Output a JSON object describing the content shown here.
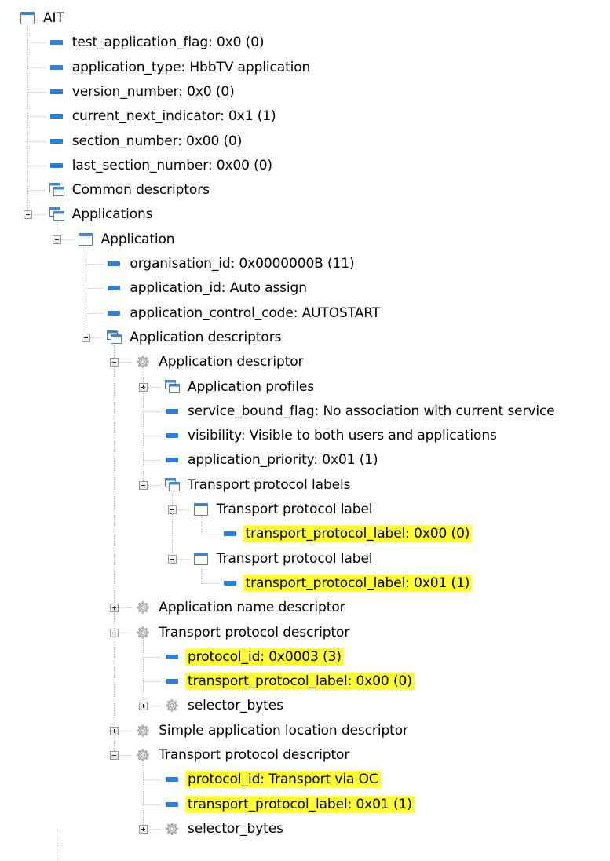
{
  "tree": {
    "nodes": [
      {
        "label": "AIT",
        "icon": "table-icon",
        "name": "node-ait"
      },
      {
        "label": "test_application_flag: 0x0 (0)",
        "icon": "field-icon",
        "name": "node-test-application-flag"
      },
      {
        "label": "application_type: HbbTV application",
        "icon": "field-icon",
        "name": "node-application-type"
      },
      {
        "label": "version_number: 0x0 (0)",
        "icon": "field-icon",
        "name": "node-version-number"
      },
      {
        "label": "current_next_indicator: 0x1 (1)",
        "icon": "field-icon",
        "name": "node-current-next-indicator"
      },
      {
        "label": "section_number: 0x00 (0)",
        "icon": "field-icon",
        "name": "node-section-number"
      },
      {
        "label": "last_section_number: 0x00 (0)",
        "icon": "field-icon",
        "name": "node-last-section-number"
      },
      {
        "label": "Common descriptors",
        "icon": "list-icon",
        "name": "node-common-descriptors"
      },
      {
        "label": "Applications",
        "icon": "list-icon",
        "name": "node-applications",
        "expanded": true
      },
      {
        "label": "Application",
        "icon": "table-icon",
        "name": "node-application",
        "expanded": true
      },
      {
        "label": "organisation_id: 0x0000000B (11)",
        "icon": "field-icon",
        "name": "node-organisation-id"
      },
      {
        "label": "application_id: Auto assign",
        "icon": "field-icon",
        "name": "node-application-id"
      },
      {
        "label": "application_control_code: AUTOSTART",
        "icon": "field-icon",
        "name": "node-application-control-code"
      },
      {
        "label": "Application descriptors",
        "icon": "list-icon",
        "name": "node-application-descriptors",
        "expanded": true
      },
      {
        "label": "Application descriptor",
        "icon": "gear-icon",
        "name": "node-application-descriptor",
        "expanded": true
      },
      {
        "label": "Application profiles",
        "icon": "list-icon",
        "name": "node-application-profiles",
        "expanded": false
      },
      {
        "label": "service_bound_flag: No association with current service",
        "icon": "field-icon",
        "name": "node-service-bound-flag"
      },
      {
        "label": "visibility: Visible to both users and applications",
        "icon": "field-icon",
        "name": "node-visibility"
      },
      {
        "label": "application_priority: 0x01 (1)",
        "icon": "field-icon",
        "name": "node-application-priority"
      },
      {
        "label": "Transport protocol labels",
        "icon": "list-icon",
        "name": "node-transport-protocol-labels",
        "expanded": true
      },
      {
        "label": "Transport protocol label",
        "icon": "table-icon",
        "name": "node-transport-protocol-label-1",
        "expanded": true
      },
      {
        "label": "transport_protocol_label: 0x00 (0)",
        "icon": "field-icon",
        "name": "node-transport-protocol-label-value-1",
        "highlighted": true
      },
      {
        "label": "Transport protocol label",
        "icon": "table-icon",
        "name": "node-transport-protocol-label-2",
        "expanded": true
      },
      {
        "label": "transport_protocol_label: 0x01 (1)",
        "icon": "field-icon",
        "name": "node-transport-protocol-label-value-2",
        "highlighted": true
      },
      {
        "label": "Application name descriptor",
        "icon": "gear-icon",
        "name": "node-application-name-descriptor",
        "expanded": false
      },
      {
        "label": "Transport protocol descriptor",
        "icon": "gear-icon",
        "name": "node-transport-protocol-descriptor-1",
        "expanded": true
      },
      {
        "label": "protocol_id: 0x0003 (3)",
        "icon": "field-icon",
        "name": "node-protocol-id-1",
        "highlighted": true
      },
      {
        "label": "transport_protocol_label: 0x00 (0)",
        "icon": "field-icon",
        "name": "node-tpd-label-1",
        "highlighted": true
      },
      {
        "label": "selector_bytes",
        "icon": "gear-icon",
        "name": "node-selector-bytes-1",
        "expanded": false
      },
      {
        "label": "Simple application location descriptor",
        "icon": "gear-icon",
        "name": "node-simple-application-location-descriptor",
        "expanded": false
      },
      {
        "label": "Transport protocol descriptor",
        "icon": "gear-icon",
        "name": "node-transport-protocol-descriptor-2",
        "expanded": true
      },
      {
        "label": "protocol_id: Transport via OC",
        "icon": "field-icon",
        "name": "node-protocol-id-2",
        "highlighted": true
      },
      {
        "label": "transport_protocol_label: 0x01 (1)",
        "icon": "field-icon",
        "name": "node-tpd-label-2",
        "highlighted": true
      },
      {
        "label": "selector_bytes",
        "icon": "gear-icon",
        "name": "node-selector-bytes-2",
        "expanded": false
      }
    ]
  },
  "colors": {
    "highlight": "#ffff33",
    "field_icon": "#2f7fd8",
    "tree_line": "#a0a0a0"
  }
}
